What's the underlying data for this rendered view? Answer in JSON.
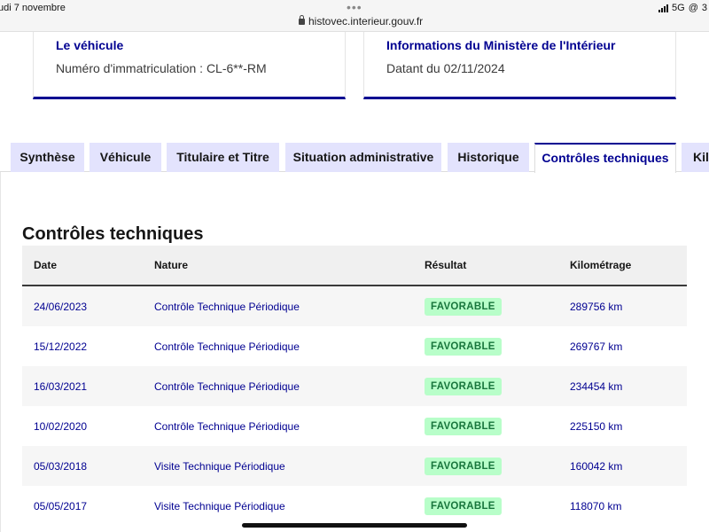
{
  "status_bar": {
    "date": "udi 7 novembre",
    "url": "histovec.interieur.gouv.fr",
    "network": "5G",
    "battery": "3"
  },
  "vehicle_card": {
    "title": "Le véhicule",
    "text": "Numéro d'immatriculation : CL-6**-RM"
  },
  "ministry_card": {
    "title": "Informations du Ministère de l'Intérieur",
    "text": "Datant du 02/11/2024"
  },
  "tabs": [
    {
      "label": "Synthèse",
      "active": false
    },
    {
      "label": "Véhicule",
      "active": false
    },
    {
      "label": "Titulaire et Titre",
      "active": false
    },
    {
      "label": "Situation administrative",
      "active": false
    },
    {
      "label": "Historique",
      "active": false
    },
    {
      "label": "Contrôles techniques",
      "active": true
    },
    {
      "label": "Kilo",
      "active": false
    }
  ],
  "section": {
    "title": "Contrôles techniques"
  },
  "table": {
    "headers": [
      "Date",
      "Nature",
      "Résultat",
      "Kilométrage"
    ],
    "rows": [
      {
        "date": "24/06/2023",
        "nature": "Contrôle Technique Périodique",
        "result": "FAVORABLE",
        "km": "289756 km"
      },
      {
        "date": "15/12/2022",
        "nature": "Contrôle Technique Périodique",
        "result": "FAVORABLE",
        "km": "269767 km"
      },
      {
        "date": "16/03/2021",
        "nature": "Contrôle Technique Périodique",
        "result": "FAVORABLE",
        "km": "234454 km"
      },
      {
        "date": "10/02/2020",
        "nature": "Contrôle Technique Périodique",
        "result": "FAVORABLE",
        "km": "225150 km"
      },
      {
        "date": "05/03/2018",
        "nature": "Visite Technique Périodique",
        "result": "FAVORABLE",
        "km": "160042 km"
      },
      {
        "date": "05/05/2017",
        "nature": "Visite Technique Périodique",
        "result": "FAVORABLE",
        "km": "118070 km"
      }
    ]
  },
  "colors": {
    "brand_blue": "#000091",
    "tab_bg": "#e3e3fd",
    "badge_bg": "#b8fec9",
    "badge_text": "#18753c"
  }
}
